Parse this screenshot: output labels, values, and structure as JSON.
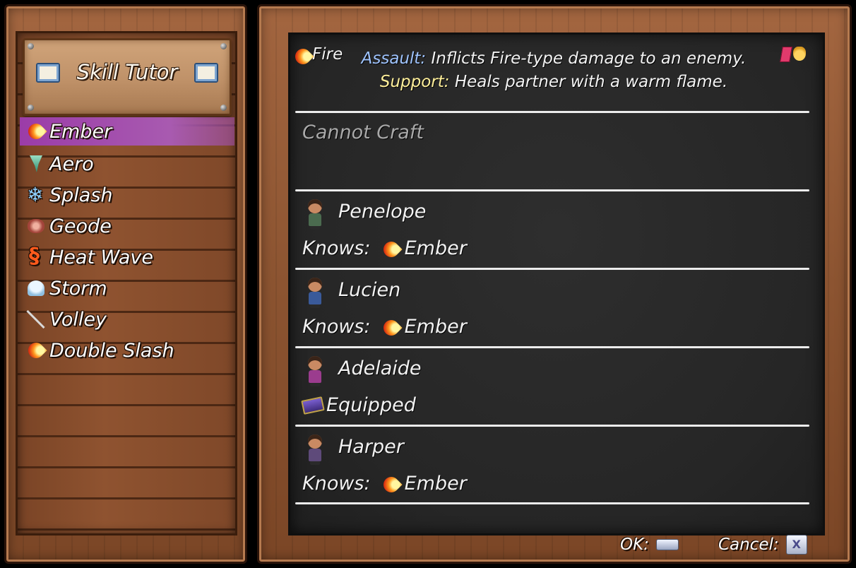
{
  "title": "Skill Tutor",
  "skills": [
    {
      "label": "Ember",
      "icon": "fire-icon",
      "selected": true
    },
    {
      "label": "Aero",
      "icon": "tornado-icon"
    },
    {
      "label": "Splash",
      "icon": "snowflake-icon"
    },
    {
      "label": "Geode",
      "icon": "rock-icon"
    },
    {
      "label": "Heat Wave",
      "icon": "heat-wave-icon"
    },
    {
      "label": "Storm",
      "icon": "storm-cloud-icon"
    },
    {
      "label": "Volley",
      "icon": "arrow-icon"
    },
    {
      "label": "Double Slash",
      "icon": "fire-slash-icon"
    }
  ],
  "detail": {
    "type_label": "Fire",
    "assault_label": "Assault:",
    "assault_text": "Inflicts Fire-type damage to an enemy.",
    "support_label": "Support:",
    "support_text": "Heals partner with a warm flame.",
    "craft_status": "Cannot Craft"
  },
  "characters": [
    {
      "name": "Penelope",
      "status_label": "Knows:",
      "status_value": "Ember",
      "status_type": "knows"
    },
    {
      "name": "Lucien",
      "status_label": "Knows:",
      "status_value": "Ember",
      "status_type": "knows"
    },
    {
      "name": "Adelaide",
      "status_label": "",
      "status_value": "Equipped",
      "status_type": "equipped"
    },
    {
      "name": "Harper",
      "status_label": "Knows:",
      "status_value": "Ember",
      "status_type": "knows"
    }
  ],
  "buttons": {
    "ok_label": "OK:",
    "cancel_label": "Cancel:",
    "cancel_key": "X"
  },
  "colors": {
    "selected_highlight": "#9b3ca8",
    "assault_label": "#9fc4ff",
    "support_label": "#ffef9a",
    "chalkboard": "#262626"
  }
}
